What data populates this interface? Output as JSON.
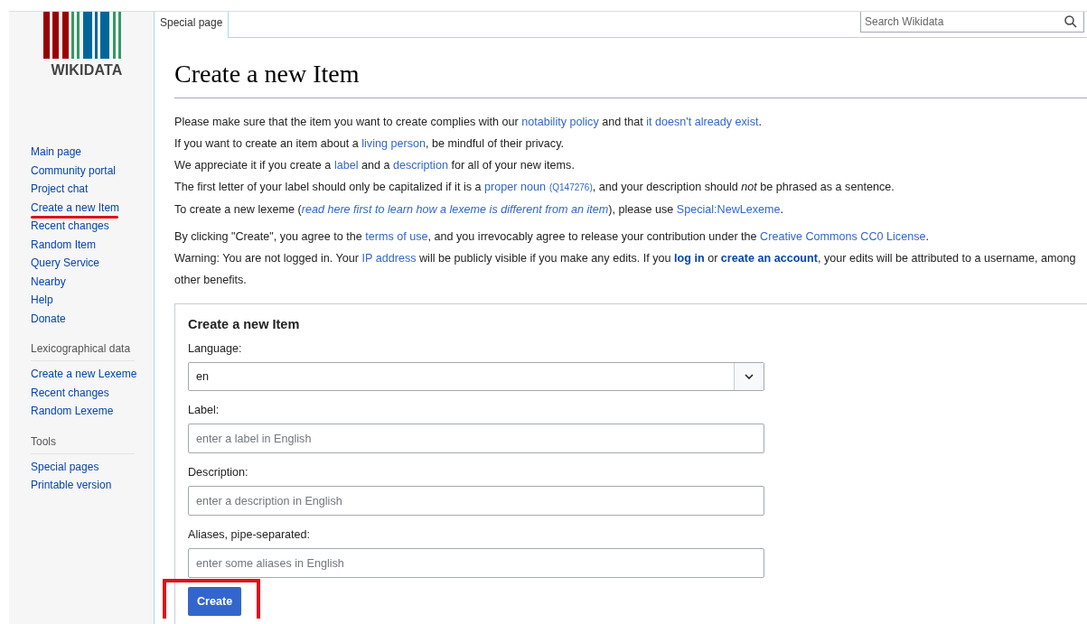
{
  "logo": {
    "wordmark": "WIKIDATA"
  },
  "tabs": [
    {
      "label": "Special page",
      "selected": true
    }
  ],
  "search": {
    "placeholder": "Search Wikidata"
  },
  "sidebar": {
    "sections": [
      {
        "items": [
          {
            "label": "Main page",
            "annotated": false
          },
          {
            "label": "Community portal",
            "annotated": false
          },
          {
            "label": "Project chat",
            "annotated": false
          },
          {
            "label": "Create a new Item",
            "annotated": true
          },
          {
            "label": "Recent changes",
            "annotated": false
          },
          {
            "label": "Random Item",
            "annotated": false
          },
          {
            "label": "Query Service",
            "annotated": false
          },
          {
            "label": "Nearby",
            "annotated": false
          },
          {
            "label": "Help",
            "annotated": false
          },
          {
            "label": "Donate",
            "annotated": false
          }
        ]
      },
      {
        "heading": "Lexicographical data",
        "items": [
          {
            "label": "Create a new Lexeme",
            "annotated": false
          },
          {
            "label": "Recent changes",
            "annotated": false
          },
          {
            "label": "Random Lexeme",
            "annotated": false
          }
        ]
      },
      {
        "heading": "Tools",
        "items": [
          {
            "label": "Special pages",
            "annotated": false
          },
          {
            "label": "Printable version",
            "annotated": false
          }
        ]
      }
    ]
  },
  "page": {
    "title": "Create a new Item",
    "intro": [
      [
        {
          "kind": "text",
          "text": "Please make sure that the item you want to create complies with our "
        },
        {
          "kind": "link",
          "text": "notability policy"
        },
        {
          "kind": "text",
          "text": " and that "
        },
        {
          "kind": "link",
          "text": "it doesn't already exist"
        },
        {
          "kind": "text",
          "text": "."
        }
      ],
      [
        {
          "kind": "text",
          "text": "If you want to create an item about a "
        },
        {
          "kind": "link",
          "text": "living person"
        },
        {
          "kind": "text",
          "text": ", be mindful of their privacy."
        }
      ],
      [
        {
          "kind": "text",
          "text": "We appreciate it if you create a "
        },
        {
          "kind": "link",
          "text": "label"
        },
        {
          "kind": "text",
          "text": " and a "
        },
        {
          "kind": "link",
          "text": "description"
        },
        {
          "kind": "text",
          "text": " for all of your new items."
        }
      ],
      [
        {
          "kind": "text",
          "text": "The first letter of your label should only be capitalized if it is a "
        },
        {
          "kind": "link",
          "text": "proper noun"
        },
        {
          "kind": "small-link",
          "text": "(Q147276)"
        },
        {
          "kind": "text",
          "text": ", and your description should *not* be phrased as a sentence."
        }
      ],
      [
        {
          "kind": "text",
          "text": "To create a new lexeme ("
        },
        {
          "kind": "italic-link",
          "text": "read here first to learn how a lexeme is different from an item"
        },
        {
          "kind": "text",
          "text": "), please use "
        },
        {
          "kind": "link",
          "text": "Special:NewLexeme"
        },
        {
          "kind": "text",
          "text": "."
        }
      ]
    ],
    "notice": [
      [
        {
          "kind": "text",
          "text": "By clicking \"Create\", you agree to the "
        },
        {
          "kind": "link",
          "text": "terms of use"
        },
        {
          "kind": "text",
          "text": ", and you irrevocably agree to release your contribution under the "
        },
        {
          "kind": "link",
          "text": "Creative Commons CC0 License"
        },
        {
          "kind": "text",
          "text": "."
        }
      ],
      [
        {
          "kind": "text",
          "text": "Warning: You are not logged in. Your "
        },
        {
          "kind": "link",
          "text": "IP address"
        },
        {
          "kind": "text",
          "text": " will be publicly visible if you make any edits. If you "
        },
        {
          "kind": "bold-link",
          "text": "log in"
        },
        {
          "kind": "text",
          "text": " or "
        },
        {
          "kind": "bold-link",
          "text": "create an account"
        },
        {
          "kind": "text",
          "text": ", your edits will be attributed to a username, among"
        }
      ],
      [
        {
          "kind": "text",
          "text": "other benefits."
        }
      ]
    ],
    "form": {
      "heading": "Create a new Item",
      "fields": [
        {
          "kind": "select",
          "label": "Language:",
          "value": "en"
        },
        {
          "kind": "text",
          "label": "Label:",
          "placeholder": "enter a label in English"
        },
        {
          "kind": "text",
          "label": "Description:",
          "placeholder": "enter a description in English"
        },
        {
          "kind": "text",
          "label": "Aliases, pipe-separated:",
          "placeholder": "enter some aliases in English"
        }
      ],
      "submit": {
        "label": "Create",
        "annotated": true
      }
    }
  }
}
